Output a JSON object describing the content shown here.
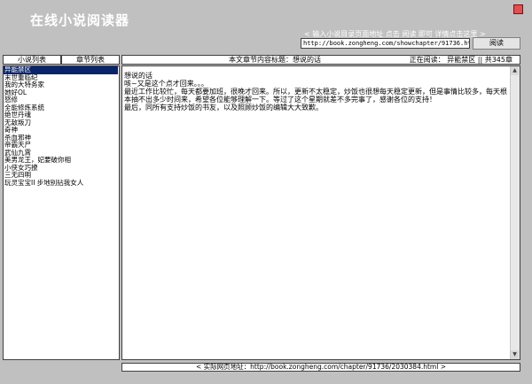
{
  "app": {
    "title": "在线小说阅读器"
  },
  "header": {
    "hint": "< 输入小说目录页面地址 点击 阅读 即可 详情点击这里 >",
    "url_value": "http://book.zongheng.com/showchapter/91736.html",
    "read_label": "阅读"
  },
  "tabs": {
    "novel_list": "小说列表",
    "chapter_list": "章节列表"
  },
  "chapter_bar": {
    "title_label": "本文章节内容标题：",
    "title_value": "想说的话",
    "reading_label": "正在阅读：",
    "reading_value": "异能禁区",
    "separator": "||",
    "total": "共345章"
  },
  "novels": [
    "异能禁区",
    "末世重临纪",
    "我的大特务家",
    "她好OL",
    "怒修",
    "全能修炼系统",
    "绝世丹魂",
    "无敌叛刀",
    "奇神",
    "杀血邪神",
    "帝霸天尸",
    "武仙九霄",
    "美男龙王，妃要破你相",
    "小侠女巧撩",
    "三无四明",
    "玩灵宝宝II 步地别拈我女人"
  ],
  "content": {
    "heading": "想说的话",
    "lines": [
      "咳~又是这个点才回来。。。",
      "最近工作比较忙，每天都要加班，很晚才回来。所以，更新不太稳定，炒饭也很想每天稳定更新，但是事情比较多，每天根本抽不出多少时间来，希望各位能够理解一下。等过了这个星期就差不多完事了，感谢各位的支持！",
      "最后，同所有支持炒饭的书友，以及照顾炒饭的编辑大大致歉。"
    ]
  },
  "footer": {
    "text": "< 实际网页地址：http://book.zongheng.com/chapter/91736/2030384.html >"
  },
  "colors": {
    "selection": "#0a246a",
    "close": "#e05050"
  }
}
